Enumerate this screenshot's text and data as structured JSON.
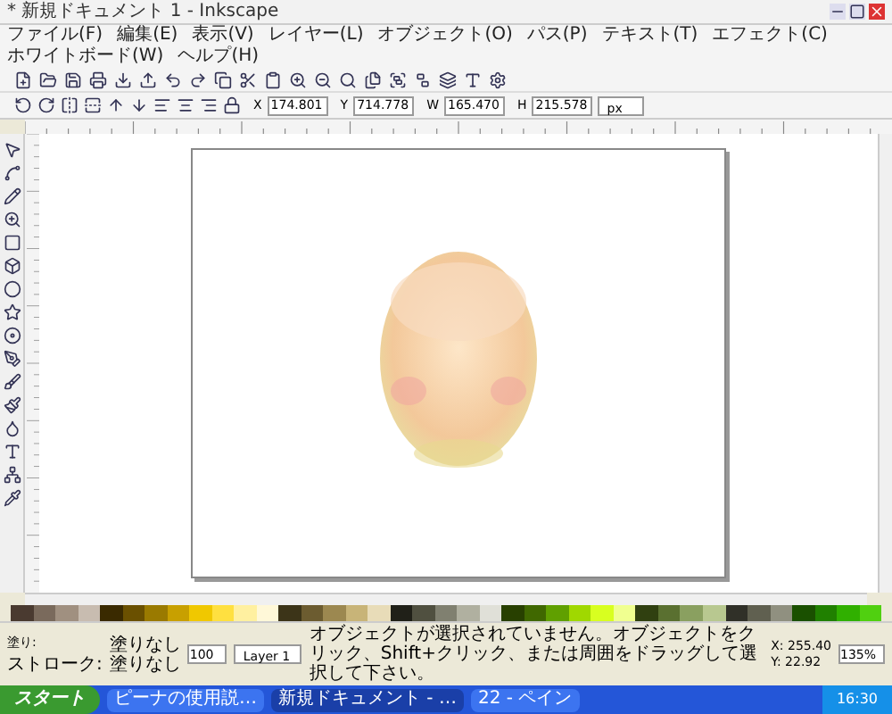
{
  "window": {
    "title": "* 新規ドキュメント 1 - Inkscape"
  },
  "menu": [
    "ファイル(F)",
    "編集(E)",
    "表示(V)",
    "レイヤー(L)",
    "オブジェクト(O)",
    "パス(P)",
    "テキスト(T)",
    "エフェクト(C)",
    "ホワイトボード(W)",
    "ヘルプ(H)"
  ],
  "tool_controls": {
    "fields": [
      {
        "label": "X",
        "value": "174.801"
      },
      {
        "label": "Y",
        "value": "714.778"
      },
      {
        "label": "W",
        "value": "165.470"
      },
      {
        "label": "H",
        "value": "215.578"
      }
    ],
    "unit": "px"
  },
  "palette": [
    {
      "color": "#4a3a30"
    },
    {
      "color": "#7a6a5c"
    },
    {
      "color": "#a09080"
    },
    {
      "color": "#c8bcb0"
    },
    {
      "color": "#3a2a00"
    },
    {
      "color": "#6a5000"
    },
    {
      "color": "#9a7a00"
    },
    {
      "color": "#c8a000"
    },
    {
      "color": "#f0c800"
    },
    {
      "color": "#ffe040"
    },
    {
      "color": "#fff0a0"
    },
    {
      "color": "#fff8d8"
    },
    {
      "color": "#3c3418"
    },
    {
      "color": "#6c5c30"
    },
    {
      "color": "#9c8850"
    },
    {
      "color": "#c8b478"
    },
    {
      "color": "#e8dcb8"
    },
    {
      "color": "#202018"
    },
    {
      "color": "#505040"
    },
    {
      "color": "#808070"
    },
    {
      "color": "#b0b0a0"
    },
    {
      "color": "#e0e0d8"
    },
    {
      "color": "#284000"
    },
    {
      "color": "#406800"
    },
    {
      "color": "#60a000"
    },
    {
      "color": "#a0d800"
    },
    {
      "color": "#d8ff20"
    },
    {
      "color": "#f0ff90"
    },
    {
      "color": "#304010"
    },
    {
      "color": "#5a7030"
    },
    {
      "color": "#8aa060"
    },
    {
      "color": "#b8c890"
    },
    {
      "color": "#303028"
    },
    {
      "color": "#606050"
    },
    {
      "color": "#909080"
    },
    {
      "color": "#1a5000"
    },
    {
      "color": "#208000"
    },
    {
      "color": "#30b000"
    },
    {
      "color": "#50d010"
    }
  ],
  "status": {
    "fill_label": "塗り:",
    "stroke_label": "ストローク:",
    "fill_value": "塗りなし",
    "stroke_value": "塗りなし",
    "opacity": "100",
    "layer": "Layer 1",
    "message": "オブジェクトが選択されていません。オブジェクトをクリック、Shift+クリック、または周囲をドラッグして選択して下さい。",
    "x": "X: 255.40",
    "y": "Y: 22.92",
    "zoom": "135%"
  },
  "taskbar": {
    "start": "スタート",
    "tasks": [
      {
        "label": "ピーナの使用説…",
        "selected": false
      },
      {
        "label": "新規ドキュメント - …",
        "selected": true
      },
      {
        "label": "22 - ペイン",
        "selected": false
      }
    ],
    "time": "16:30"
  }
}
